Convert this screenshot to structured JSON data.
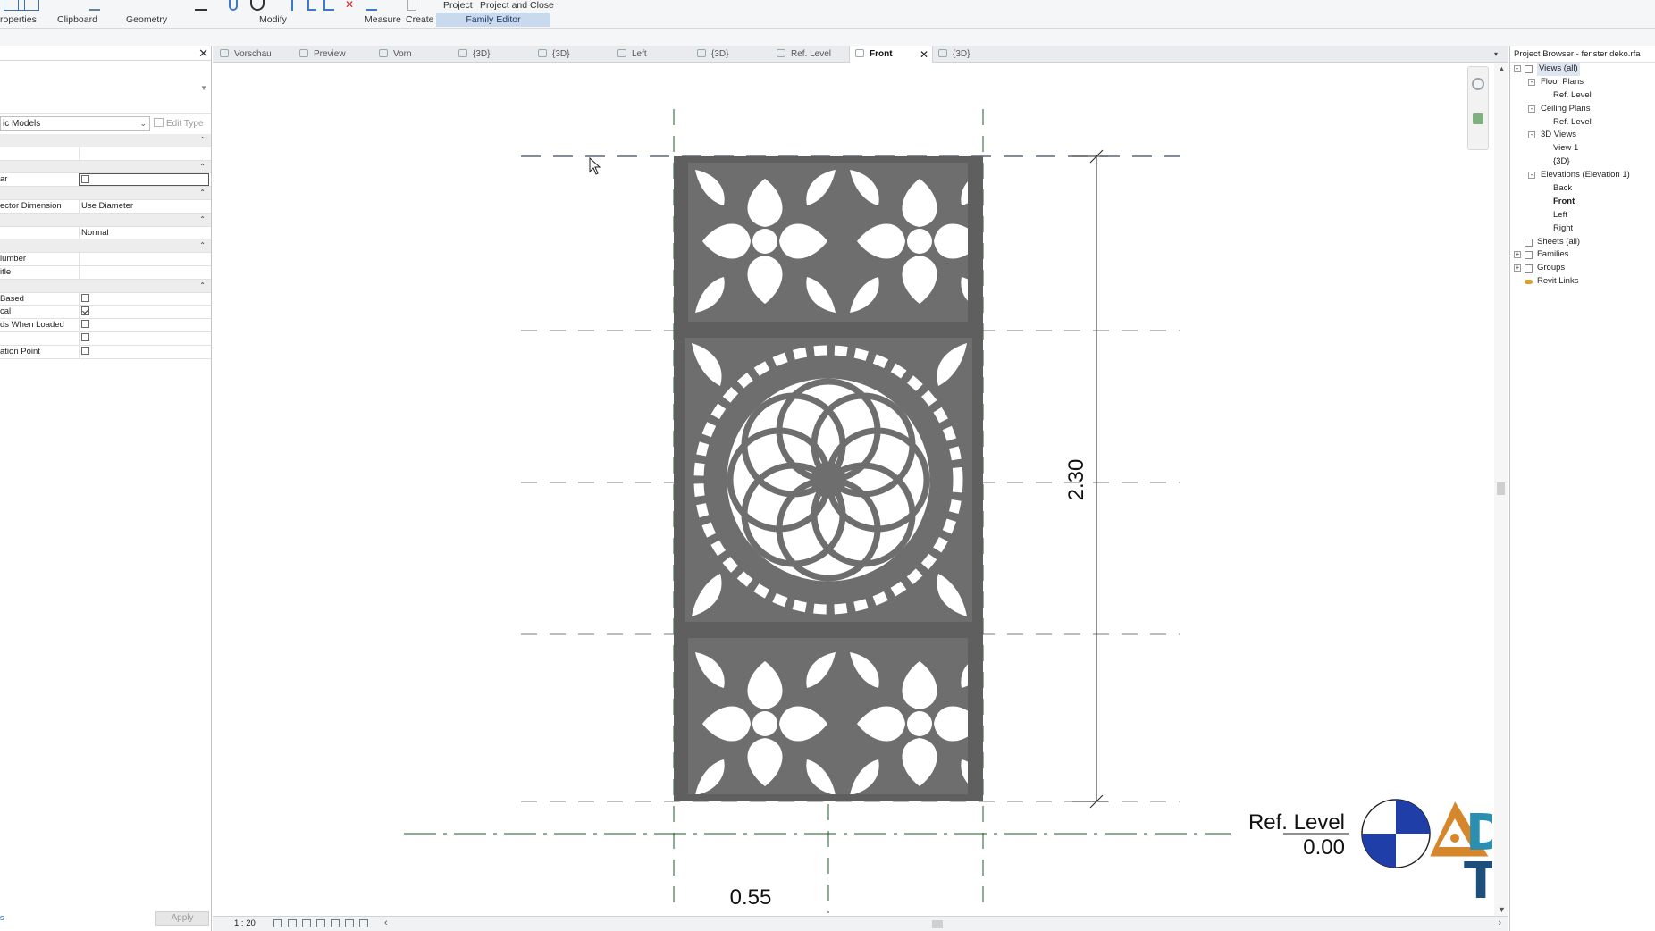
{
  "ribbon": {
    "properties_label": "roperties",
    "clipboard_label": "Clipboard",
    "geometry_label": "Geometry",
    "modify_label": "Modify",
    "measure_label": "Measure",
    "create_label": "Create",
    "project_label": "Project",
    "project_close_label": "Project and Close",
    "family_editor_label": "Family Editor"
  },
  "properties": {
    "type_selector": "ic Models",
    "edit_type": "Edit Type",
    "rows": [
      {
        "group": true
      },
      {
        "key": "",
        "value": ""
      },
      {
        "group": true
      },
      {
        "key": "ar",
        "value": "",
        "checkbox": "empty-box"
      },
      {
        "group": true
      },
      {
        "key": "ector Dimension",
        "value": "Use Diameter"
      },
      {
        "group": true
      },
      {
        "key": "",
        "value": "Normal"
      },
      {
        "group": true
      },
      {
        "key": "lumber",
        "value": ""
      },
      {
        "key": "itle",
        "value": ""
      },
      {
        "group": true
      },
      {
        "key": "Based",
        "value": "",
        "checkbox": "off"
      },
      {
        "key": "cal",
        "value": "",
        "checkbox": "on"
      },
      {
        "key": "ds When Loaded",
        "value": "",
        "checkbox": "off"
      },
      {
        "key": "",
        "value": "",
        "checkbox": "off"
      },
      {
        "key": "ation Point",
        "value": "",
        "checkbox": "off"
      }
    ],
    "apply": "Apply",
    "help_link": "s"
  },
  "tabs": [
    "Vorschau",
    "Preview",
    "Vorn",
    "{3D}",
    "{3D}",
    "Left",
    "{3D}",
    "Ref. Level",
    "Front",
    "{3D}"
  ],
  "active_tab": "Front",
  "drawing": {
    "height_dim": "2.30",
    "width_dim": "0.55",
    "level_name": "Ref. Level",
    "level_elev": "0.00"
  },
  "status": {
    "scale": "1 : 20"
  },
  "browser": {
    "title": "Project Browser - fenster deko.rfa",
    "tree": [
      {
        "label": "Views (all)",
        "level": 0,
        "toggle": "-",
        "selected": true
      },
      {
        "label": "Floor Plans",
        "level": 1,
        "toggle": "-"
      },
      {
        "label": "Ref. Level",
        "level": 2
      },
      {
        "label": "Ceiling Plans",
        "level": 1,
        "toggle": "-"
      },
      {
        "label": "Ref. Level",
        "level": 2
      },
      {
        "label": "3D Views",
        "level": 1,
        "toggle": "-"
      },
      {
        "label": "View 1",
        "level": 2
      },
      {
        "label": "{3D}",
        "level": 2
      },
      {
        "label": "Elevations (Elevation 1)",
        "level": 1,
        "toggle": "-"
      },
      {
        "label": "Back",
        "level": 2
      },
      {
        "label": "Front",
        "level": 2,
        "bold": true
      },
      {
        "label": "Left",
        "level": 2
      },
      {
        "label": "Right",
        "level": 2
      },
      {
        "label": "Sheets (all)",
        "level": 0
      },
      {
        "label": "Families",
        "level": 0,
        "toggle": "+"
      },
      {
        "label": "Groups",
        "level": 0,
        "toggle": "+"
      },
      {
        "label": "Revit Links",
        "level": 0,
        "icon": "link-icon"
      }
    ]
  },
  "logo": {
    "line1": "DEKO",
    "line2": "TEKT"
  },
  "colors": {
    "panel": "#6e6e6e",
    "frame": "#5f5f5f",
    "logo_blue": "#2a8fb0",
    "logo_orange": "#d6862b",
    "ref_plane": "#1f5a2a"
  }
}
